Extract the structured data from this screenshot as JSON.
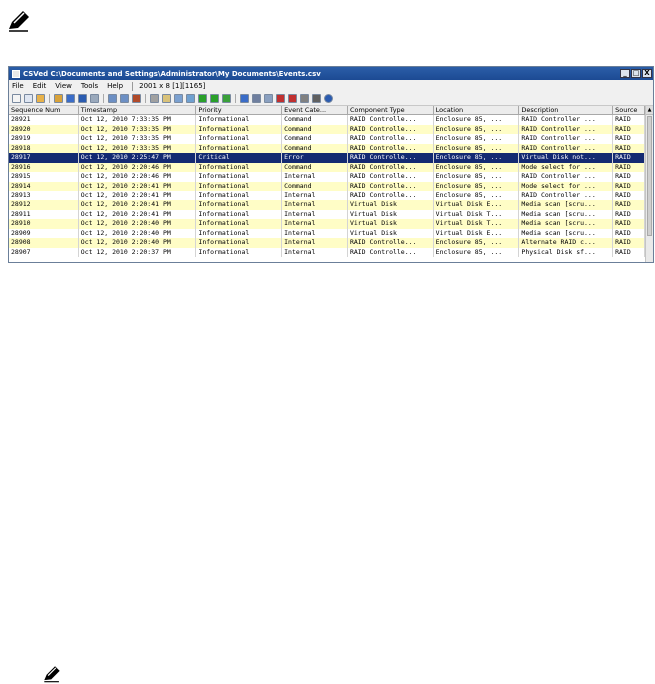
{
  "window": {
    "title": "CSVed C:\\Documents and Settings\\Administrator\\My Documents\\Events.csv",
    "minimize_label": "_",
    "maximize_label": "□",
    "close_label": "X"
  },
  "menu": {
    "items": [
      "File",
      "Edit",
      "View",
      "Tools",
      "Help"
    ],
    "status": "2001 x 8 [1][1165]"
  },
  "toolbar": {
    "icons": [
      "new-file-icon",
      "copy-icon",
      "import-icon",
      "open-icon",
      "save-icon",
      "print-icon",
      "export-icon",
      "undo-icon",
      "redo-icon",
      "book-icon",
      "cut-icon",
      "paste-icon",
      "image-icon",
      "swap-icon",
      "check-icon",
      "green-check-icon",
      "ok-icon",
      "find-icon",
      "search-icon",
      "columns-icon",
      "delete-col-icon",
      "delete-icon",
      "settings-icon",
      "grid-icon",
      "help-icon"
    ]
  },
  "grid": {
    "columns": [
      "Sequence Num",
      "Timestamp",
      "Priority",
      "Event Cate...",
      "Component Type",
      "Location",
      "Description",
      "Source"
    ],
    "selected_row": 4,
    "rows": [
      [
        "28921",
        "Oct 12, 2010 7:33:35 PM",
        "Informational",
        "Command",
        "RAID Controlle...",
        "Enclosure 85, ...",
        "RAID Controller ...",
        "RAID"
      ],
      [
        "28920",
        "Oct 12, 2010 7:33:35 PM",
        "Informational",
        "Command",
        "RAID Controlle...",
        "Enclosure 85, ...",
        "RAID Controller ...",
        "RAID"
      ],
      [
        "28919",
        "Oct 12, 2010 7:33:35 PM",
        "Informational",
        "Command",
        "RAID Controlle...",
        "Enclosure 85, ...",
        "RAID Controller ...",
        "RAID"
      ],
      [
        "28918",
        "Oct 12, 2010 7:33:35 PM",
        "Informational",
        "Command",
        "RAID Controlle...",
        "Enclosure 85, ...",
        "RAID Controller ...",
        "RAID"
      ],
      [
        "28917",
        "Oct 12, 2010 2:25:47 PM",
        "Critical",
        "Error",
        "RAID Controlle...",
        "Enclosure 85, ...",
        "Virtual Disk not...",
        "RAID"
      ],
      [
        "28916",
        "Oct 12, 2010 2:20:46 PM",
        "Informational",
        "Command",
        "RAID Controlle...",
        "Enclosure 85, ...",
        "Mode select for ...",
        "RAID"
      ],
      [
        "28915",
        "Oct 12, 2010 2:20:46 PM",
        "Informational",
        "Internal",
        "RAID Controlle...",
        "Enclosure 85, ...",
        "RAID Controller ...",
        "RAID"
      ],
      [
        "28914",
        "Oct 12, 2010 2:20:41 PM",
        "Informational",
        "Command",
        "RAID Controlle...",
        "Enclosure 85, ...",
        "Mode select for ...",
        "RAID"
      ],
      [
        "28913",
        "Oct 12, 2010 2:20:41 PM",
        "Informational",
        "Internal",
        "RAID Controlle...",
        "Enclosure 85, ...",
        "RAID Controller ...",
        "RAID"
      ],
      [
        "28912",
        "Oct 12, 2010 2:20:41 PM",
        "Informational",
        "Internal",
        "Virtual Disk",
        "Virtual Disk E...",
        "Media scan [scru...",
        "RAID"
      ],
      [
        "28911",
        "Oct 12, 2010 2:20:41 PM",
        "Informational",
        "Internal",
        "Virtual Disk",
        "Virtual Disk T...",
        "Media scan [scru...",
        "RAID"
      ],
      [
        "28910",
        "Oct 12, 2010 2:20:40 PM",
        "Informational",
        "Internal",
        "Virtual Disk",
        "Virtual Disk T...",
        "Media scan [scru...",
        "RAID"
      ],
      [
        "28909",
        "Oct 12, 2010 2:20:40 PM",
        "Informational",
        "Internal",
        "Virtual Disk",
        "Virtual Disk E...",
        "Media scan [scru...",
        "RAID"
      ],
      [
        "28908",
        "Oct 12, 2010 2:20:40 PM",
        "Informational",
        "Internal",
        "RAID Controlle...",
        "Enclosure 85, ...",
        "Alternate RAID c...",
        "RAID"
      ],
      [
        "28907",
        "Oct 12, 2010 2:20:37 PM",
        "Informational",
        "Internal",
        "RAID Controlle...",
        "Enclosure 85, ...",
        "Physical Disk sf...",
        "RAID"
      ]
    ]
  },
  "colors": {
    "row_highlight": "#fffdc6",
    "selected_row": "#142a72",
    "titlebar": "#1c4a93"
  }
}
